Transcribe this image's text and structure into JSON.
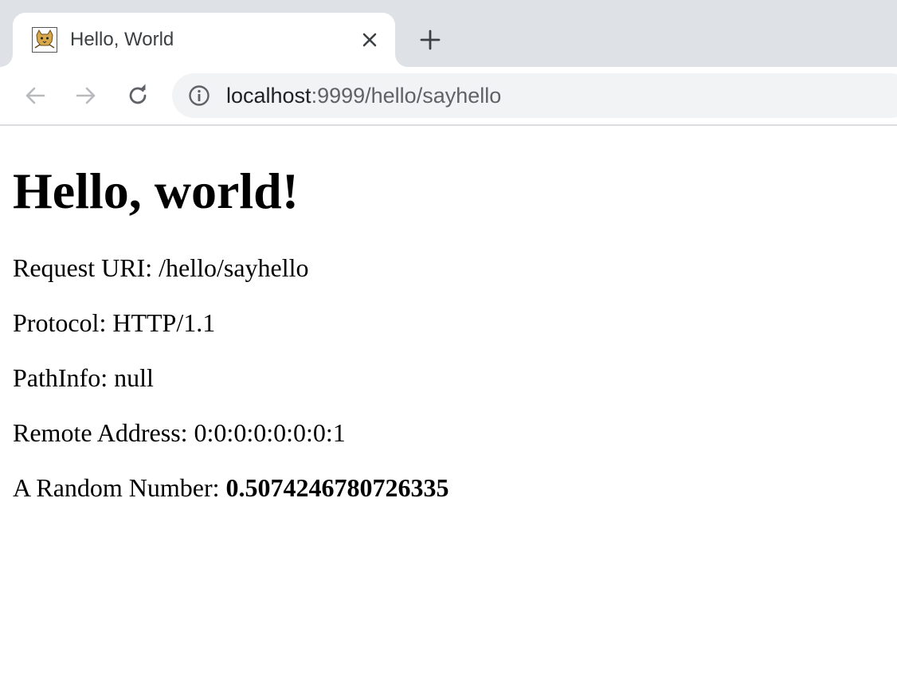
{
  "browser": {
    "tab": {
      "title": "Hello, World",
      "favicon": "tomcat-icon"
    },
    "toolbar": {
      "url_host": "localhost",
      "url_rest": ":9999/hello/sayhello",
      "security_icon": "info-icon"
    },
    "icons": {
      "close": "close-icon",
      "new_tab": "plus-icon",
      "back": "back-arrow-icon",
      "forward": "forward-arrow-icon",
      "reload": "reload-icon"
    }
  },
  "page": {
    "heading": "Hello, world!",
    "lines": [
      {
        "label": "Request URI: ",
        "value": "/hello/sayhello"
      },
      {
        "label": "Protocol: ",
        "value": "HTTP/1.1"
      },
      {
        "label": "PathInfo: ",
        "value": "null"
      },
      {
        "label": "Remote Address: ",
        "value": "0:0:0:0:0:0:0:1"
      },
      {
        "label": "A Random Number: ",
        "value": "0.5074246780726335"
      }
    ]
  }
}
